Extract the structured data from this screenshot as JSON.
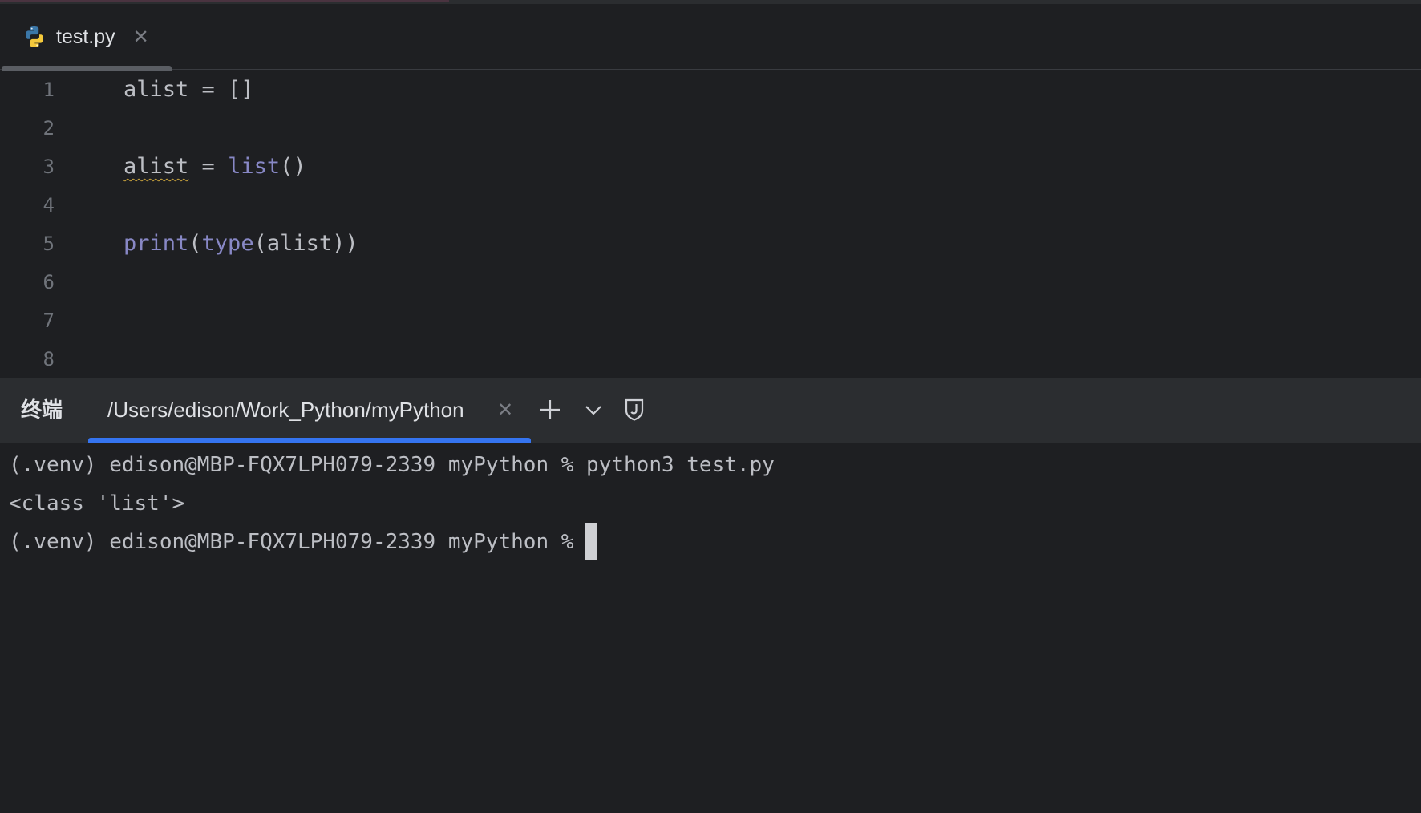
{
  "editor": {
    "tab": {
      "label": "test.py",
      "icon": "python-file-icon"
    },
    "lines": [
      {
        "num": "1",
        "parts": [
          {
            "text": "alist = []",
            "cls": ""
          }
        ]
      },
      {
        "num": "2",
        "parts": []
      },
      {
        "num": "3",
        "parts": [
          {
            "text": "alist",
            "cls": "squiggle"
          },
          {
            "text": " = ",
            "cls": ""
          },
          {
            "text": "list",
            "cls": "kw-builtin"
          },
          {
            "text": "()",
            "cls": ""
          }
        ]
      },
      {
        "num": "4",
        "parts": []
      },
      {
        "num": "5",
        "parts": [
          {
            "text": "print",
            "cls": "kw-builtin"
          },
          {
            "text": "(",
            "cls": ""
          },
          {
            "text": "type",
            "cls": "kw-builtin"
          },
          {
            "text": "(alist))",
            "cls": ""
          }
        ]
      },
      {
        "num": "6",
        "parts": []
      },
      {
        "num": "7",
        "parts": []
      },
      {
        "num": "8",
        "parts": []
      }
    ]
  },
  "terminal": {
    "title": "终端",
    "tab_label": "/Users/edison/Work_Python/myPython",
    "lines": [
      "(.venv) edison@MBP-FQX7LPH079-2339 myPython % python3 test.py",
      "<class 'list'>",
      "(.venv) edison@MBP-FQX7LPH079-2339 myPython %"
    ],
    "accent_color": "#3574f0"
  }
}
